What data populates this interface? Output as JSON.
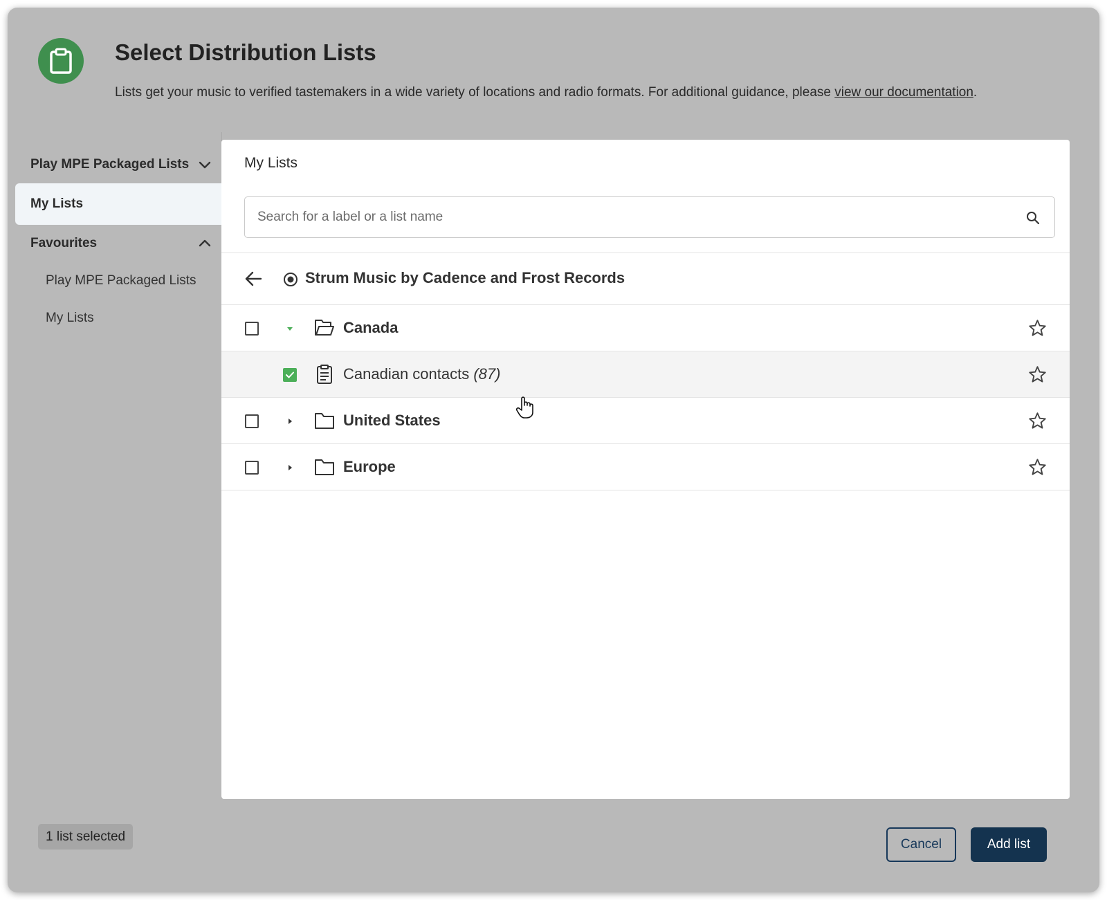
{
  "header": {
    "title": "Select Distribution Lists",
    "description": "Lists get your music to verified tastemakers in a wide variety of locations and radio formats. For additional guidance, please ",
    "doc_link": "view our documentation",
    "description_end": ".",
    "icon": "clipboard-icon",
    "icon_bg": "#3f8f4e"
  },
  "sidebar": {
    "items": [
      {
        "label": "Play MPE Packaged Lists",
        "icon": "chevron-down-icon"
      },
      {
        "label": "My Lists",
        "active": true
      },
      {
        "label": "Favourites",
        "icon": "chevron-up-icon"
      },
      {
        "label": "Play MPE Packaged Lists"
      },
      {
        "label": "My Lists"
      }
    ]
  },
  "main": {
    "title": "My Lists",
    "search": {
      "placeholder": "Search for a label or a list name",
      "value": ""
    },
    "breadcrumb": {
      "label": "Strum Music by Cadence and Frost Records"
    },
    "rows": [
      {
        "label": "Canada",
        "type": "folder-open",
        "checked": false,
        "expanded": true
      },
      {
        "label": "Canadian contacts",
        "count": "(87)",
        "type": "list",
        "checked": true
      },
      {
        "label": "United States",
        "type": "folder",
        "checked": false,
        "expanded": false
      },
      {
        "label": "Europe",
        "type": "folder",
        "checked": false,
        "expanded": false
      }
    ]
  },
  "footer": {
    "selected_count": "1 list selected",
    "cancel_label": "Cancel",
    "add_label": "Add list"
  },
  "colors": {
    "accent_green": "#4caf59",
    "primary_navy": "#14334f",
    "overlay_gray": "#b9b9b9"
  }
}
